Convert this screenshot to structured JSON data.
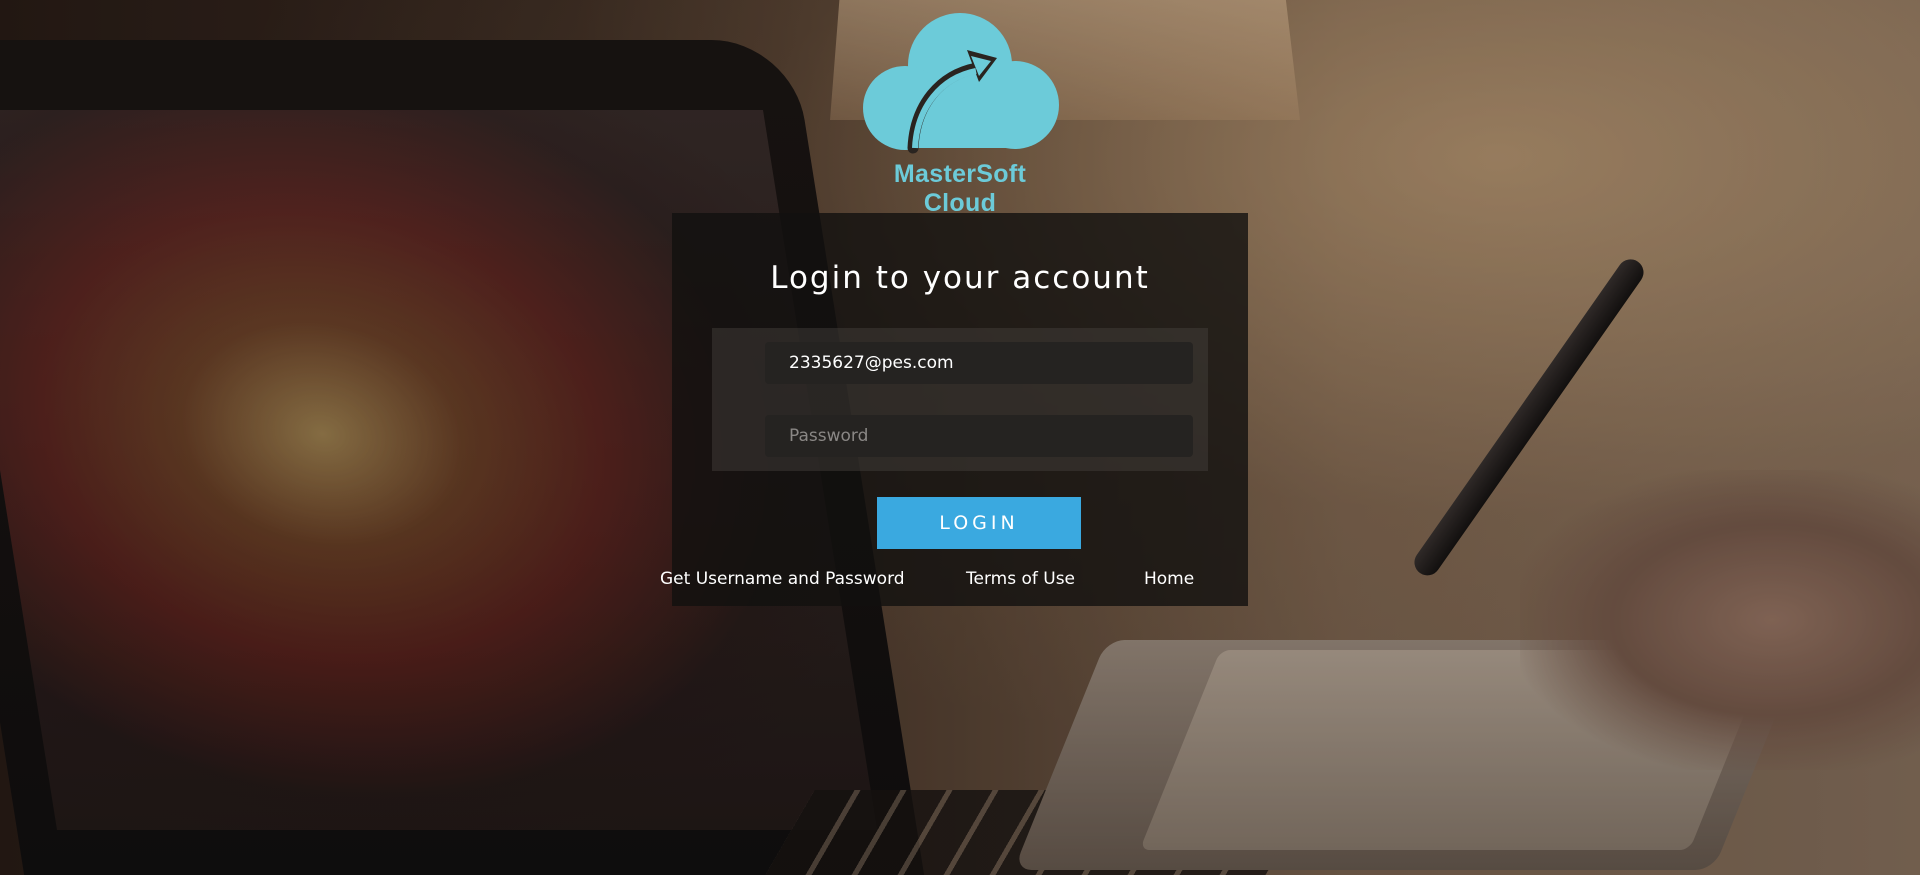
{
  "brand": {
    "name": "MasterSoft Cloud",
    "logo_color": "#6ccbd9"
  },
  "login": {
    "title": "Login to your account",
    "email_value": "2335627@pes.com",
    "password_placeholder": "Password",
    "submit_label": "LOGIN",
    "accent_color": "#3aa9e0"
  },
  "links": {
    "credentials": "Get Username and Password",
    "terms": "Terms of Use",
    "home": "Home"
  }
}
